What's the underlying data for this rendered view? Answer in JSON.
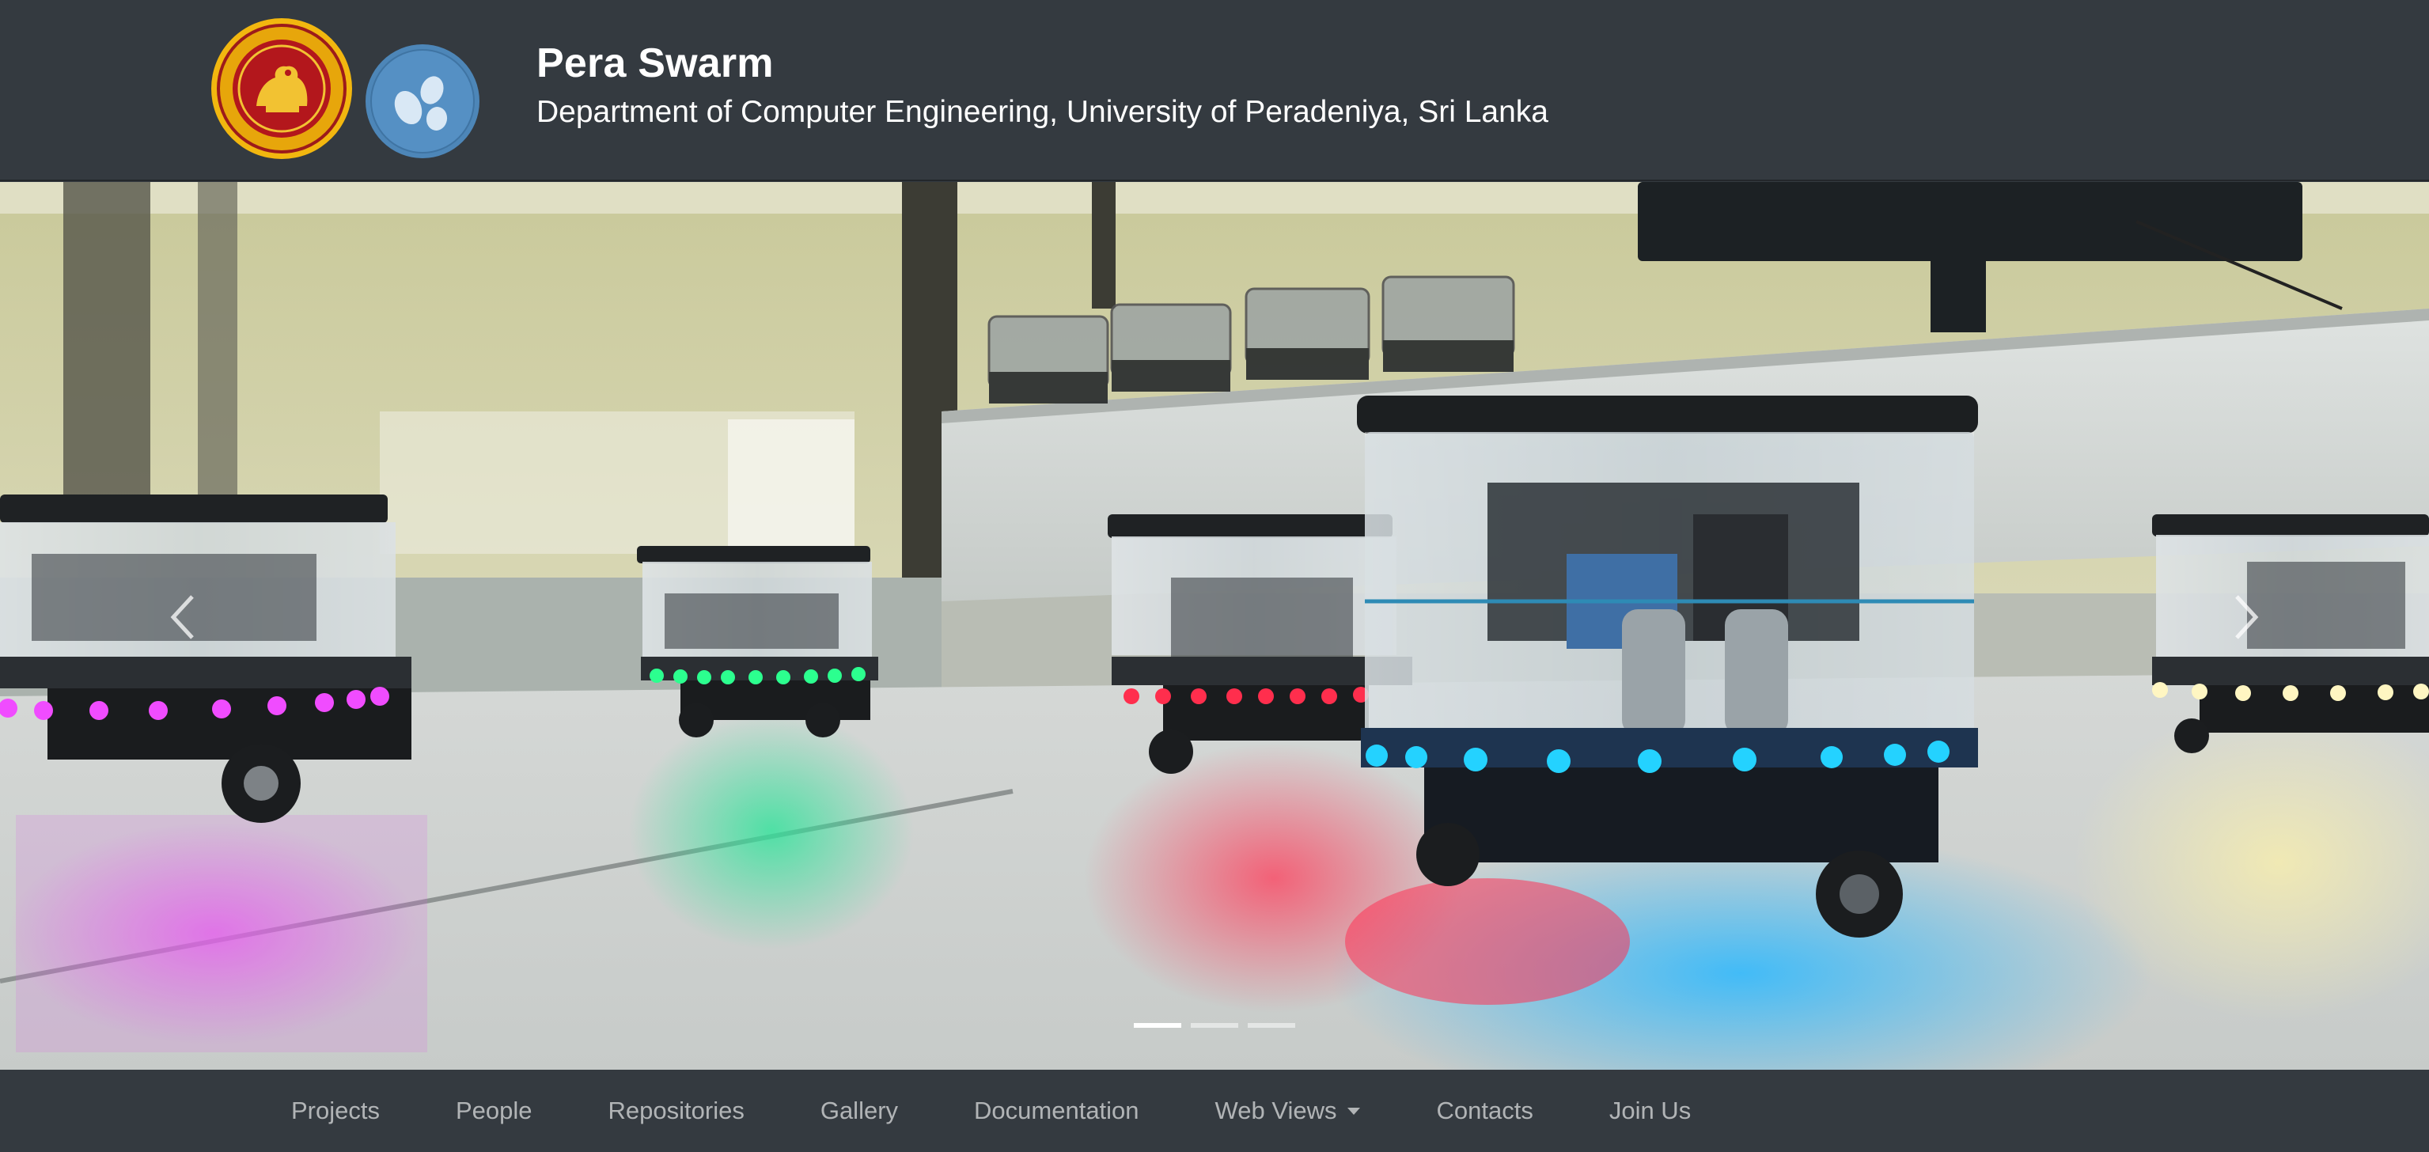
{
  "header": {
    "title": "Pera Swarm",
    "subtitle": "Department of Computer Engineering, University of Peradeniya, Sri Lanka",
    "logos": [
      "university-of-peradeniya-crest",
      "pera-swarm-logo"
    ]
  },
  "carousel": {
    "slide_count": 3,
    "active_index": 0,
    "prev_icon": "chevron-left-icon",
    "next_icon": "chevron-right-icon",
    "led_colors": [
      "#e83cff",
      "#22ff88",
      "#ff2850",
      "#22c8ff",
      "#fff4b0"
    ]
  },
  "nav": {
    "items": [
      {
        "label": "Projects"
      },
      {
        "label": "People"
      },
      {
        "label": "Repositories"
      },
      {
        "label": "Gallery"
      },
      {
        "label": "Documentation"
      },
      {
        "label": "Web Views",
        "dropdown": true
      },
      {
        "label": "Contacts"
      },
      {
        "label": "Join Us"
      }
    ]
  },
  "colors": {
    "header_bg": "#343a40",
    "nav_text": "#9da0a3",
    "brand_text": "#ffffff"
  }
}
